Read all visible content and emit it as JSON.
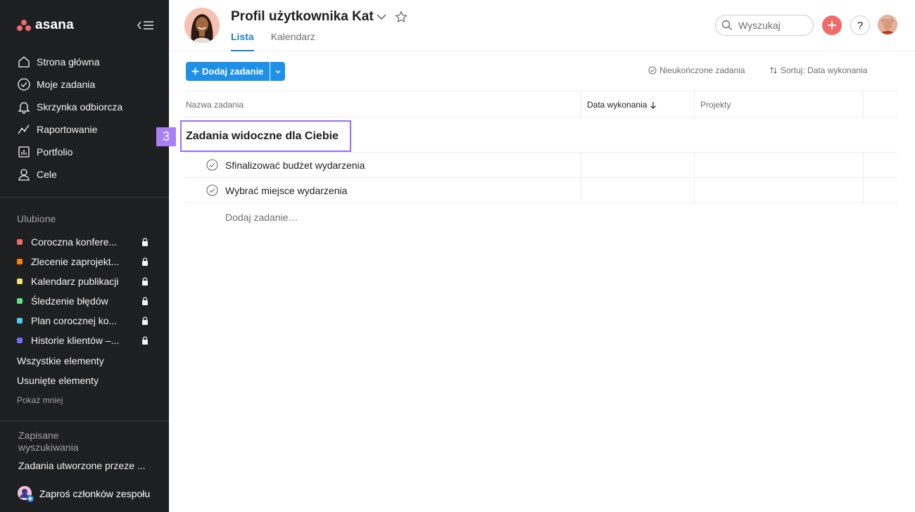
{
  "app": {
    "brand": "asana"
  },
  "sidebar": {
    "nav": [
      {
        "label": "Strona główna",
        "icon": "home-icon"
      },
      {
        "label": "Moje zadania",
        "icon": "check-circle-icon"
      },
      {
        "label": "Skrzynka odbiorcza",
        "icon": "bell-icon"
      },
      {
        "label": "Raportowanie",
        "icon": "chart-line-icon"
      },
      {
        "label": "Portfolio",
        "icon": "portfolio-icon"
      },
      {
        "label": "Cele",
        "icon": "person-icon"
      }
    ],
    "favorites_title": "Ulubione",
    "favorites": [
      {
        "label": "Coroczna konfere...",
        "color": "#f06a6a"
      },
      {
        "label": "Zlecenie zaprojekt...",
        "color": "#fd7e14"
      },
      {
        "label": "Kalendarz publikacji",
        "color": "#f8df72"
      },
      {
        "label": "Śledzenie błędów",
        "color": "#5de38b"
      },
      {
        "label": "Plan corocznej ko...",
        "color": "#4ecbf4"
      },
      {
        "label": "Historie klientów –...",
        "color": "#6d6ff6"
      }
    ],
    "all_items": "Wszystkie elementy",
    "deleted_items": "Usunięte elementy",
    "show_less": "Pokaż mniej",
    "saved_searches_title": "Zapisane wyszukiwania",
    "saved_search_item": "Zadania utworzone przeze ...",
    "invite_label": "Zaproś członków zespołu"
  },
  "header": {
    "title": "Profil użytkownika Kat",
    "tabs": [
      {
        "label": "Lista",
        "active": true
      },
      {
        "label": "Kalendarz",
        "active": false
      }
    ],
    "search_placeholder": "Wyszukaj",
    "help_label": "?"
  },
  "toolbar": {
    "add_task": "Dodaj zadanie",
    "filter_incomplete": "Nieukończone zadania",
    "sort": "Sortuj: Data wykonania"
  },
  "table": {
    "columns": [
      "Nazwa zadania",
      "Data wykonania",
      "Projekty"
    ],
    "section_title": "Zadania widoczne dla Ciebie",
    "step_number": "3",
    "tasks": [
      {
        "name": "Sfinalizować budżet wydarzenia"
      },
      {
        "name": "Wybrać miejsce wydarzenia"
      }
    ],
    "add_task_inline": "Dodaj zadanie…"
  },
  "colors": {
    "sidebar_bg": "#1e1f21",
    "accent_blue": "#1e90e6",
    "brand_coral": "#f06a6a",
    "highlight_purple": "#9b6df1"
  }
}
